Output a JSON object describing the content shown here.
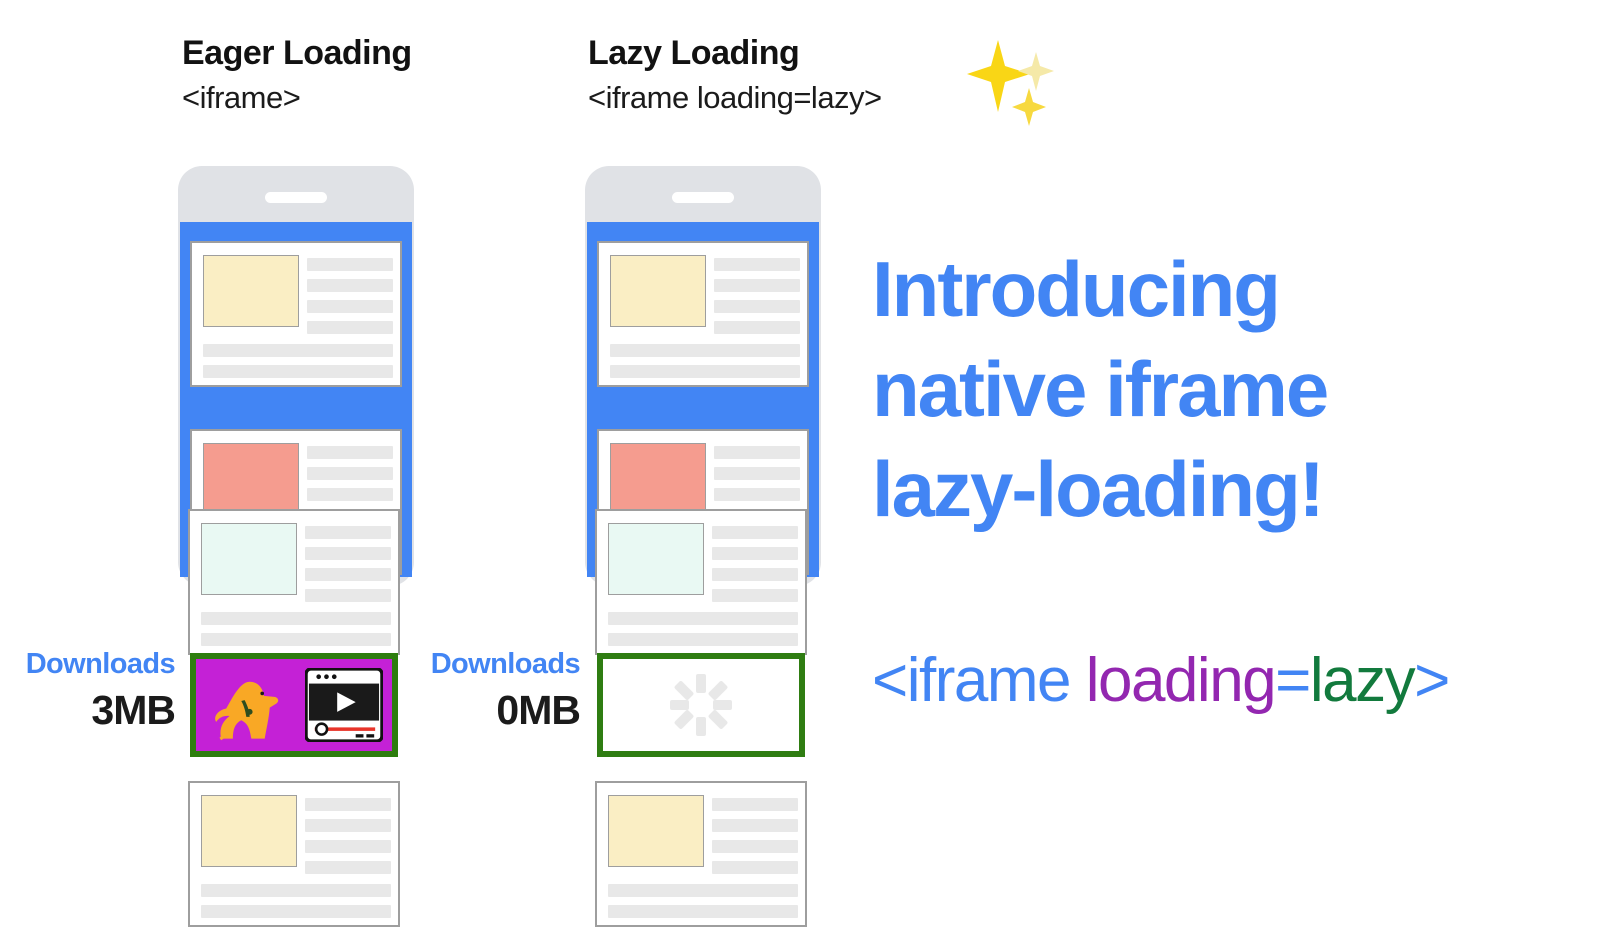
{
  "columns": [
    {
      "title": "Eager Loading",
      "code": "<iframe>",
      "downloads_label": "Downloads",
      "downloads_value": "3MB"
    },
    {
      "title": "Lazy Loading",
      "code": "<iframe loading=lazy>",
      "downloads_label": "Downloads",
      "downloads_value": "0MB"
    }
  ],
  "sparkles_icon": "sparkles-icon",
  "headline": {
    "line1": "Introducing",
    "line2": "native iframe",
    "line3": "lazy-loading!"
  },
  "code_snippet": {
    "tag_open": "<iframe",
    "attribute": " loading",
    "equals": "=",
    "value": "lazy",
    "tag_close": ">"
  },
  "colors": {
    "accent_blue": "#4285f4",
    "phone_body": "#e0e2e6",
    "iframe_border_green": "#2e7d0e",
    "eager_iframe_bg": "#c421d6",
    "code_attribute_purple": "#9327b0",
    "code_value_green": "#127a3d",
    "thumb_cream": "#faeec4",
    "thumb_salmon": "#f59c8f",
    "thumb_mint": "#e9f9f3",
    "skeleton_line": "#e8e8e8"
  },
  "phone_cards": [
    {
      "thumb_color": "#faeec4"
    },
    {
      "thumb_color": "#f59c8f"
    },
    {
      "thumb_color": "#e9f9f3"
    },
    {
      "thumb_color": "#faeec4"
    }
  ],
  "icons": {
    "dog": "dog-icon",
    "video_player": "video-player-icon",
    "spinner": "loading-spinner-icon",
    "notch": "phone-speaker-notch"
  }
}
